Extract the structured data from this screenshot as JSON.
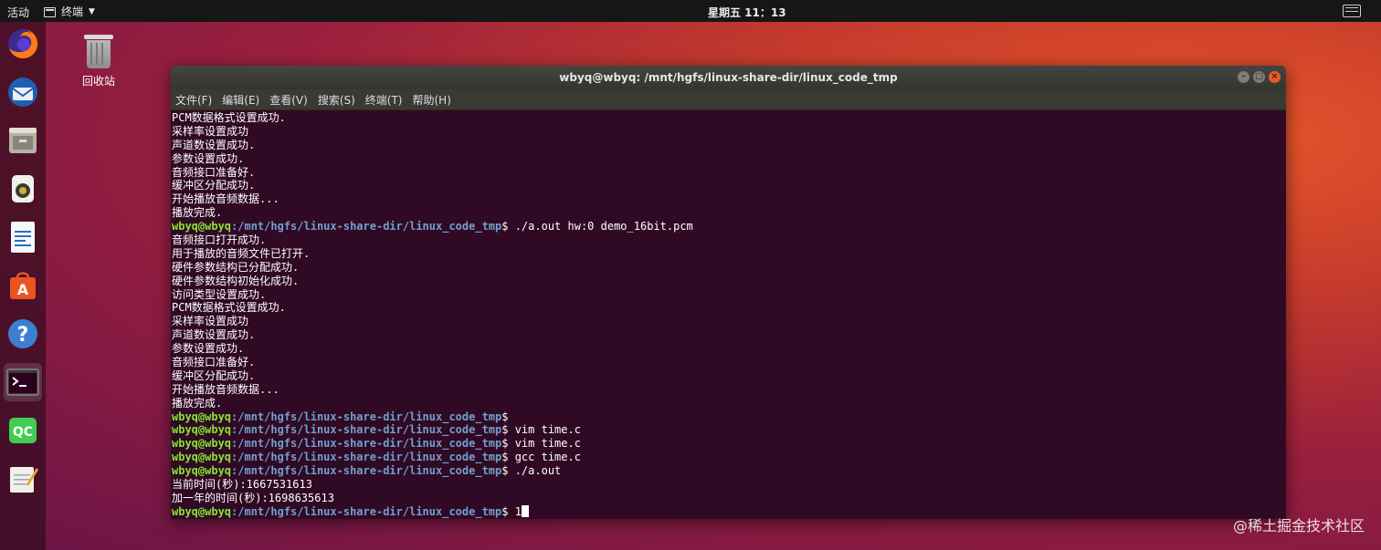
{
  "topbar": {
    "activities": "活动",
    "app_name": "终端",
    "clock": "星期五 11：13"
  },
  "dock": {
    "items": [
      "firefox",
      "thunderbird",
      "files",
      "rhythmbox",
      "libreoffice-writer",
      "ubuntu-software",
      "help",
      "terminal",
      "qt-creator",
      "text-editor"
    ],
    "active": "terminal"
  },
  "desktop": {
    "trash_label": "回收站"
  },
  "terminal": {
    "title": "wbyq@wbyq: /mnt/hgfs/linux-share-dir/linux_code_tmp",
    "menu": [
      "文件(F)",
      "编辑(E)",
      "查看(V)",
      "搜索(S)",
      "终端(T)",
      "帮助(H)"
    ],
    "prompt_user": "wbyq@wbyq",
    "prompt_path": ":/mnt/hgfs/linux-share-dir/linux_code_tmp",
    "prompt_sep": "$ ",
    "lines": [
      {
        "out": "PCM数据格式设置成功."
      },
      {
        "out": "采样率设置成功"
      },
      {
        "out": "声道数设置成功."
      },
      {
        "out": "参数设置成功."
      },
      {
        "out": "音频接口准备好."
      },
      {
        "out": "缓冲区分配成功."
      },
      {
        "out": "开始播放音频数据..."
      },
      {
        "out": "播放完成."
      },
      {
        "cmd": "./a.out hw:0 demo_16bit.pcm"
      },
      {
        "out": "音频接口打开成功."
      },
      {
        "out": "用于播放的音频文件已打开."
      },
      {
        "out": "硬件参数结构已分配成功."
      },
      {
        "out": "硬件参数结构初始化成功."
      },
      {
        "out": "访问类型设置成功."
      },
      {
        "out": "PCM数据格式设置成功."
      },
      {
        "out": "采样率设置成功"
      },
      {
        "out": "声道数设置成功."
      },
      {
        "out": "参数设置成功."
      },
      {
        "out": "音频接口准备好."
      },
      {
        "out": "缓冲区分配成功."
      },
      {
        "out": "开始播放音频数据..."
      },
      {
        "out": "播放完成."
      },
      {
        "cmd": ""
      },
      {
        "cmd": "vim time.c"
      },
      {
        "cmd": "vim time.c"
      },
      {
        "cmd": "gcc time.c"
      },
      {
        "cmd": "./a.out"
      },
      {
        "out": "当前时间(秒):1667531613"
      },
      {
        "out": "加一年的时间(秒):1698635613"
      },
      {
        "cmd": "1",
        "cursor": true
      }
    ]
  },
  "watermark": "@稀土掘金技术社区"
}
